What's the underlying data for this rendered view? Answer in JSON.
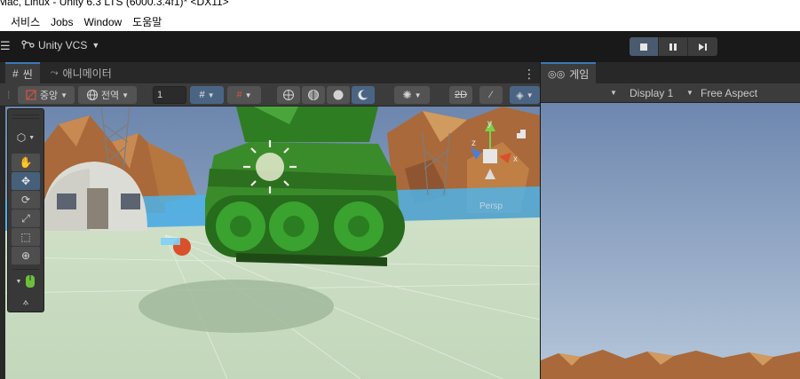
{
  "window": {
    "title": "Mac, Linux - Unity 6.3 LTS (6000.3.4f1)* <DX11>"
  },
  "menu": [
    "서비스",
    "Jobs",
    "Window",
    "도움말"
  ],
  "toolbar": {
    "vcs_label": "Unity VCS"
  },
  "scene": {
    "tab_label": "씬",
    "animation_tab_label": "애니메이터",
    "pivot_label": "중앙",
    "space_label": "전역",
    "grid_value": "1"
  },
  "game": {
    "tab_label": "게임",
    "display_label": "Display 1",
    "aspect_label": "Free Aspect"
  },
  "gizmo": {
    "y_label": "y",
    "x_label": "x",
    "z_label": "z",
    "persp_label": "Persp"
  },
  "colors": {
    "accent": "#3a79bb",
    "sky_top": "#7b93b8",
    "ground": "#c8dcc0",
    "tank_green": "#3a8c2a"
  }
}
